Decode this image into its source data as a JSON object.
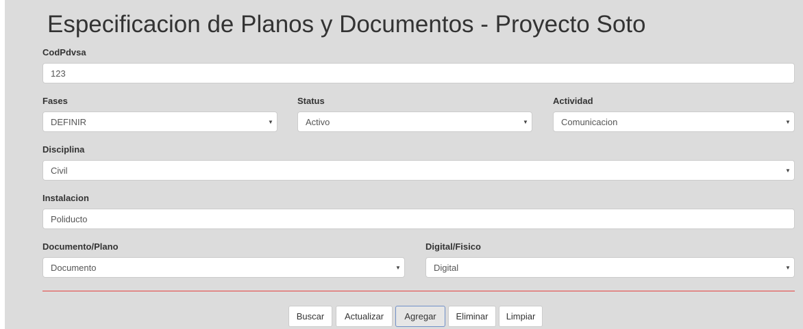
{
  "page": {
    "title": "Especificacion de Planos y Documentos - Proyecto Soto"
  },
  "form": {
    "codpdvsa": {
      "label": "CodPdvsa",
      "value": "123"
    },
    "fases": {
      "label": "Fases",
      "value": "DEFINIR"
    },
    "status": {
      "label": "Status",
      "value": "Activo"
    },
    "actividad": {
      "label": "Actividad",
      "value": "Comunicacion"
    },
    "disciplina": {
      "label": "Disciplina",
      "value": "Civil"
    },
    "instalacion": {
      "label": "Instalacion",
      "value": "Poliducto"
    },
    "documento_plano": {
      "label": "Documento/Plano",
      "value": "Documento"
    },
    "digital_fisico": {
      "label": "Digital/Fisico",
      "value": "Digital"
    }
  },
  "buttons": {
    "buscar": "Buscar",
    "actualizar": "Actualizar",
    "agregar": "Agregar",
    "eliminar": "Eliminar",
    "limpiar": "Limpiar"
  },
  "icons": {
    "select_caret": "chevron-down-icon"
  },
  "colors": {
    "background": "#dcdcdc",
    "divider": "#e4423f",
    "active_button_border": "#6f8fc7"
  }
}
